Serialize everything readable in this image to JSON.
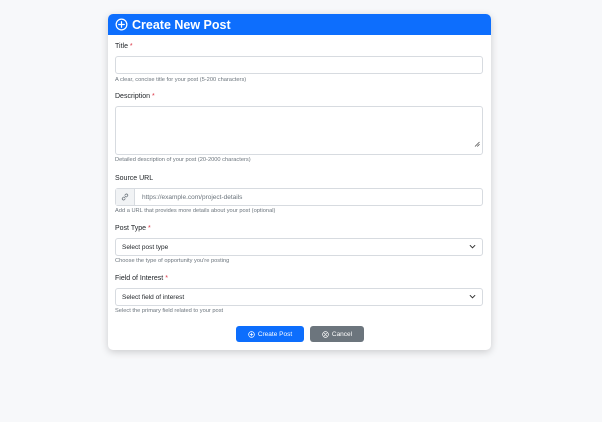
{
  "header": {
    "title": "Create New Post"
  },
  "fields": {
    "title": {
      "label": "Title",
      "required_mark": "*",
      "value": "",
      "help": "A clear, concise title for your post (5-200 characters)"
    },
    "description": {
      "label": "Description",
      "required_mark": "*",
      "value": "",
      "help": "Detailed description of your post (20-2000 characters)"
    },
    "source_url": {
      "label": "Source URL",
      "placeholder": "https://example.com/project-details",
      "icon": "link-icon",
      "help": "Add a URL that provides more details about your post (optional)"
    },
    "post_type": {
      "label": "Post Type",
      "required_mark": "*",
      "selected": "Select post type",
      "help": "Choose the type of opportunity you're posting"
    },
    "field_of_interest": {
      "label": "Field of Interest",
      "required_mark": "*",
      "selected": "Select field of interest",
      "help": "Select the primary field related to your post"
    }
  },
  "actions": {
    "create_label": "Create Post",
    "cancel_label": "Cancel"
  },
  "colors": {
    "primary": "#0d6efd",
    "secondary": "#6c757d",
    "required": "#dc3545",
    "page_bg": "#f7f8fa"
  }
}
